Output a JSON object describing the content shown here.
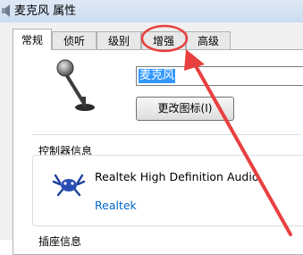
{
  "window": {
    "title": "麦克风 属性",
    "icon": "speaker-icon"
  },
  "tabs": [
    {
      "label": "常规",
      "active": true
    },
    {
      "label": "侦听",
      "active": false
    },
    {
      "label": "级别",
      "active": false
    },
    {
      "label": "增强",
      "active": false,
      "highlighted": true
    },
    {
      "label": "高级",
      "active": false
    }
  ],
  "general": {
    "device_icon": "microphone-icon",
    "name_value": "麦克风",
    "change_icon_button": "更改图标(I)",
    "controller_label": "控制器信息",
    "controller": {
      "logo": "realtek-crab-icon",
      "name": "Realtek High Definition Audio",
      "vendor_link": "Realtek"
    },
    "next_section_label": "插座信息"
  },
  "annotation": {
    "color": "#e84040",
    "shapes": [
      "highlight-circle",
      "pointer-arrow"
    ]
  },
  "colors": {
    "selection": "#3399ff",
    "link": "#0066cc",
    "annotation": "#e84040"
  }
}
